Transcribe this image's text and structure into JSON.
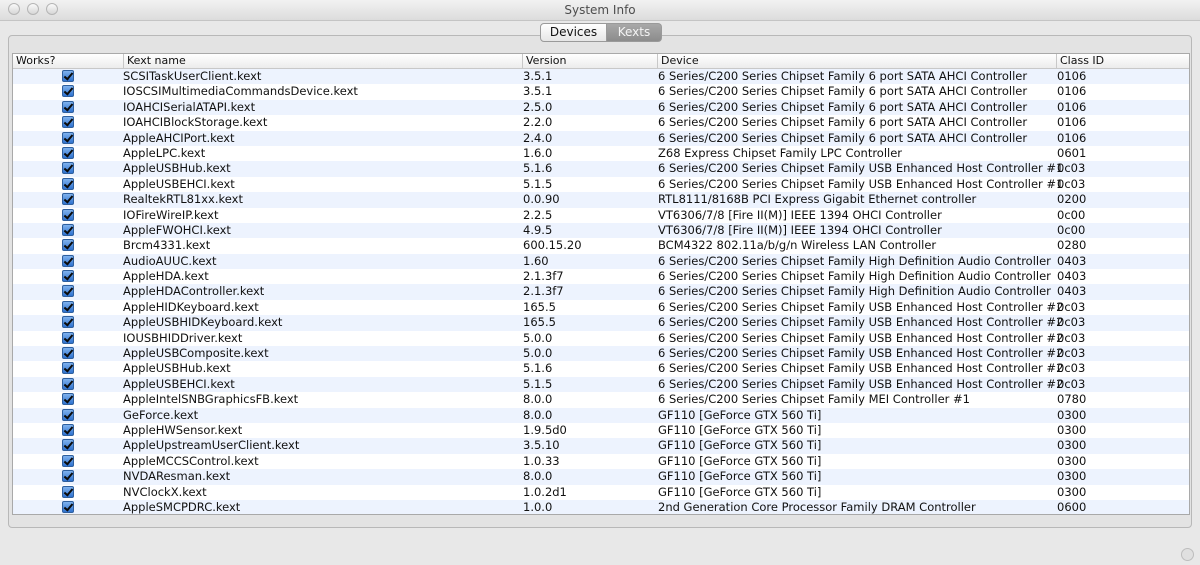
{
  "window": {
    "title": "System Info"
  },
  "tabs": [
    {
      "label": "Devices",
      "selected": false
    },
    {
      "label": "Kexts",
      "selected": true
    }
  ],
  "table": {
    "columns": [
      "Works?",
      "Kext name",
      "Version",
      "Device",
      "Class ID"
    ],
    "rows": [
      {
        "works": true,
        "name": "SCSITaskUserClient.kext",
        "version": "3.5.1",
        "device": "6 Series/C200 Series Chipset Family 6 port SATA AHCI Controller",
        "class_id": "0106"
      },
      {
        "works": true,
        "name": "IOSCSIMultimediaCommandsDevice.kext",
        "version": "3.5.1",
        "device": "6 Series/C200 Series Chipset Family 6 port SATA AHCI Controller",
        "class_id": "0106"
      },
      {
        "works": true,
        "name": "IOAHCISerialATAPI.kext",
        "version": "2.5.0",
        "device": "6 Series/C200 Series Chipset Family 6 port SATA AHCI Controller",
        "class_id": "0106"
      },
      {
        "works": true,
        "name": "IOAHCIBlockStorage.kext",
        "version": "2.2.0",
        "device": "6 Series/C200 Series Chipset Family 6 port SATA AHCI Controller",
        "class_id": "0106"
      },
      {
        "works": true,
        "name": "AppleAHCIPort.kext",
        "version": "2.4.0",
        "device": "6 Series/C200 Series Chipset Family 6 port SATA AHCI Controller",
        "class_id": "0106"
      },
      {
        "works": true,
        "name": "AppleLPC.kext",
        "version": "1.6.0",
        "device": "Z68 Express Chipset Family LPC Controller",
        "class_id": "0601"
      },
      {
        "works": true,
        "name": "AppleUSBHub.kext",
        "version": "5.1.6",
        "device": "6 Series/C200 Series Chipset Family USB Enhanced Host Controller #1",
        "class_id": "0c03"
      },
      {
        "works": true,
        "name": "AppleUSBEHCI.kext",
        "version": "5.1.5",
        "device": "6 Series/C200 Series Chipset Family USB Enhanced Host Controller #1",
        "class_id": "0c03"
      },
      {
        "works": true,
        "name": "RealtekRTL81xx.kext",
        "version": "0.0.90",
        "device": "RTL8111/8168B PCI Express Gigabit Ethernet controller",
        "class_id": "0200"
      },
      {
        "works": true,
        "name": "IOFireWireIP.kext",
        "version": "2.2.5",
        "device": "VT6306/7/8 [Fire II(M)] IEEE 1394 OHCI Controller",
        "class_id": "0c00"
      },
      {
        "works": true,
        "name": "AppleFWOHCI.kext",
        "version": "4.9.5",
        "device": "VT6306/7/8 [Fire II(M)] IEEE 1394 OHCI Controller",
        "class_id": "0c00"
      },
      {
        "works": true,
        "name": "Brcm4331.kext",
        "version": "600.15.20",
        "device": "BCM4322 802.11a/b/g/n Wireless LAN Controller",
        "class_id": "0280"
      },
      {
        "works": true,
        "name": "AudioAUUC.kext",
        "version": "1.60",
        "device": "6 Series/C200 Series Chipset Family High Definition Audio Controller",
        "class_id": "0403"
      },
      {
        "works": true,
        "name": "AppleHDA.kext",
        "version": "2.1.3f7",
        "device": "6 Series/C200 Series Chipset Family High Definition Audio Controller",
        "class_id": "0403"
      },
      {
        "works": true,
        "name": "AppleHDAController.kext",
        "version": "2.1.3f7",
        "device": "6 Series/C200 Series Chipset Family High Definition Audio Controller",
        "class_id": "0403"
      },
      {
        "works": true,
        "name": "AppleHIDKeyboard.kext",
        "version": "165.5",
        "device": "6 Series/C200 Series Chipset Family USB Enhanced Host Controller #2",
        "class_id": "0c03"
      },
      {
        "works": true,
        "name": "AppleUSBHIDKeyboard.kext",
        "version": "165.5",
        "device": "6 Series/C200 Series Chipset Family USB Enhanced Host Controller #2",
        "class_id": "0c03"
      },
      {
        "works": true,
        "name": "IOUSBHIDDriver.kext",
        "version": "5.0.0",
        "device": "6 Series/C200 Series Chipset Family USB Enhanced Host Controller #2",
        "class_id": "0c03"
      },
      {
        "works": true,
        "name": "AppleUSBComposite.kext",
        "version": "5.0.0",
        "device": "6 Series/C200 Series Chipset Family USB Enhanced Host Controller #2",
        "class_id": "0c03"
      },
      {
        "works": true,
        "name": "AppleUSBHub.kext",
        "version": "5.1.6",
        "device": "6 Series/C200 Series Chipset Family USB Enhanced Host Controller #2",
        "class_id": "0c03"
      },
      {
        "works": true,
        "name": "AppleUSBEHCI.kext",
        "version": "5.1.5",
        "device": "6 Series/C200 Series Chipset Family USB Enhanced Host Controller #2",
        "class_id": "0c03"
      },
      {
        "works": true,
        "name": "AppleIntelSNBGraphicsFB.kext",
        "version": "8.0.0",
        "device": "6 Series/C200 Series Chipset Family MEI Controller #1",
        "class_id": "0780"
      },
      {
        "works": true,
        "name": "GeForce.kext",
        "version": "8.0.0",
        "device": "GF110 [GeForce GTX 560 Ti]",
        "class_id": "0300"
      },
      {
        "works": true,
        "name": "AppleHWSensor.kext",
        "version": "1.9.5d0",
        "device": "GF110 [GeForce GTX 560 Ti]",
        "class_id": "0300"
      },
      {
        "works": true,
        "name": "AppleUpstreamUserClient.kext",
        "version": "3.5.10",
        "device": "GF110 [GeForce GTX 560 Ti]",
        "class_id": "0300"
      },
      {
        "works": true,
        "name": "AppleMCCSControl.kext",
        "version": "1.0.33",
        "device": "GF110 [GeForce GTX 560 Ti]",
        "class_id": "0300"
      },
      {
        "works": true,
        "name": "NVDAResman.kext",
        "version": "8.0.0",
        "device": "GF110 [GeForce GTX 560 Ti]",
        "class_id": "0300"
      },
      {
        "works": true,
        "name": "NVClockX.kext",
        "version": "1.0.2d1",
        "device": "GF110 [GeForce GTX 560 Ti]",
        "class_id": "0300"
      },
      {
        "works": true,
        "name": "AppleSMCPDRC.kext",
        "version": "1.0.0",
        "device": "2nd Generation Core Processor Family DRAM Controller",
        "class_id": "0600"
      }
    ]
  }
}
